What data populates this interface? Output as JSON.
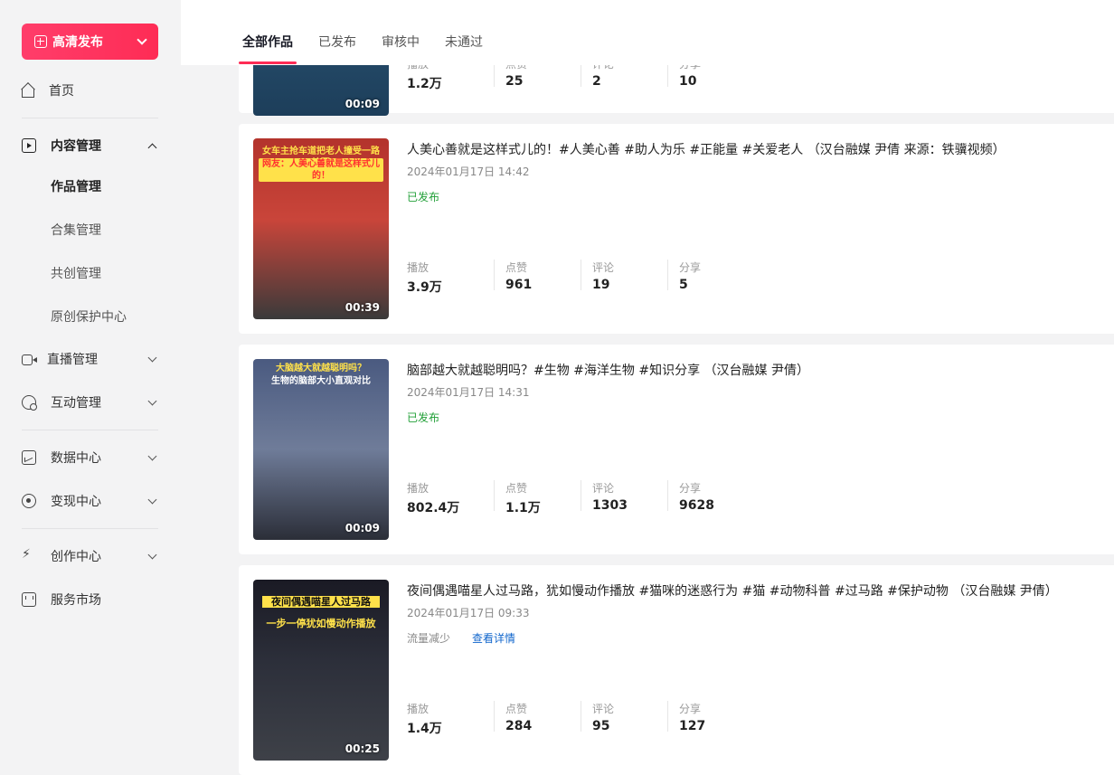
{
  "sidebar": {
    "publish_label": "高清发布",
    "items": {
      "home": "首页",
      "content": "内容管理",
      "works": "作品管理",
      "collections": "合集管理",
      "co_create": "共创管理",
      "original": "原创保护中心",
      "live": "直播管理",
      "interaction": "互动管理",
      "data": "数据中心",
      "monetize": "变现中心",
      "create": "创作中心",
      "market": "服务市场"
    }
  },
  "tabs": [
    "全部作品",
    "已发布",
    "审核中",
    "未通过"
  ],
  "stat_labels": {
    "play": "播放",
    "like": "点赞",
    "comment": "评论",
    "share": "分享"
  },
  "videos": [
    {
      "duration": "00:09",
      "stats": {
        "play": "1.2万",
        "like": "25",
        "comment": "2",
        "share": "10"
      }
    },
    {
      "title": "人美心善就是这样式儿的！#人美心善 #助人为乐 #正能量 #关爱老人 （汉台融媒 尹倩 来源：铁骥视频）",
      "time": "2024年01月17日 14:42",
      "status": "已发布",
      "duration": "00:39",
      "thumb_caption_1": "女车主抢车道把老人撞受一路惊醒",
      "thumb_caption_2": "网友：人美心善就是这样式儿的！",
      "stats": {
        "play": "3.9万",
        "like": "961",
        "comment": "19",
        "share": "5"
      }
    },
    {
      "title": "脑部越大就越聪明吗？#生物 #海洋生物 #知识分享 （汉台融媒 尹倩）",
      "time": "2024年01月17日 14:31",
      "status": "已发布",
      "duration": "00:09",
      "thumb_caption_1": "大脑越大就越聪明吗？",
      "thumb_caption_2": "生物的脑部大小直观对比",
      "stats": {
        "play": "802.4万",
        "like": "1.1万",
        "comment": "1303",
        "share": "9628"
      }
    },
    {
      "title": "夜间偶遇喵星人过马路，犹如慢动作播放 #猫咪的迷惑行为 #猫 #动物科普 #过马路 #保护动物 （汉台融媒 尹倩）",
      "time": "2024年01月17日 09:33",
      "status": "流量减少",
      "detail_link": "查看详情",
      "duration": "00:25",
      "thumb_caption_1": "夜间偶遇喵星人过马路",
      "thumb_caption_2": "一步一停犹如慢动作播放",
      "stats": {
        "play": "1.4万",
        "like": "284",
        "comment": "95",
        "share": "127"
      }
    }
  ]
}
